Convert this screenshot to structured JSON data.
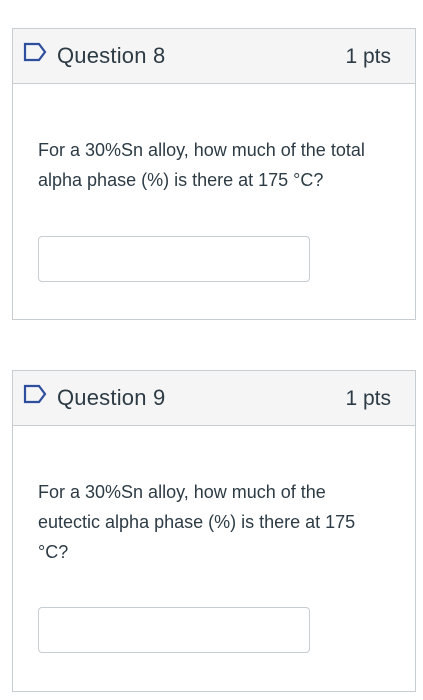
{
  "questions": [
    {
      "title": "Question 8",
      "points": "1 pts",
      "text": "For a 30%Sn alloy, how much of the total alpha phase (%) is there at 175  °C?",
      "answer_value": ""
    },
    {
      "title": "Question 9",
      "points": "1 pts",
      "text": "For a 30%Sn alloy, how much of the eutectic alpha phase (%) is there at 175 °C?",
      "answer_value": ""
    }
  ],
  "colors": {
    "flag_stroke": "#2d4f9e",
    "border": "#c7cdd1",
    "header_bg": "#f5f5f5",
    "text": "#2d3b45"
  },
  "icons": {
    "flag": "bookmark-flag-icon"
  }
}
